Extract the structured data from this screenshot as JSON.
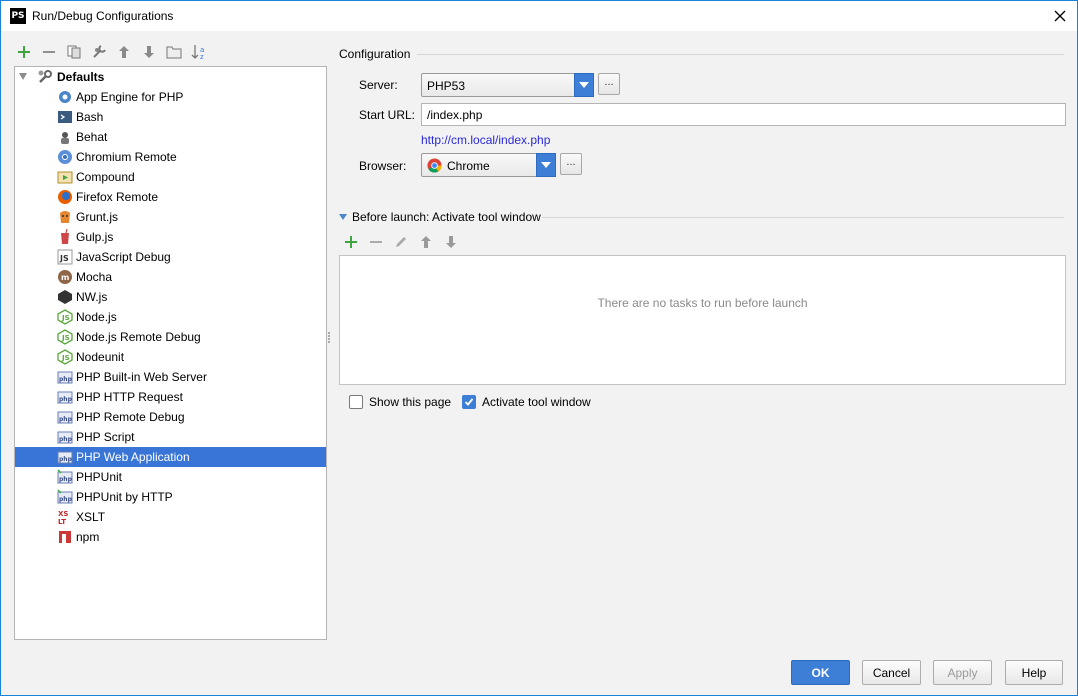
{
  "window": {
    "title": "Run/Debug Configurations",
    "app_icon_text": "PS"
  },
  "toolbar": {
    "buttons": [
      "add-icon",
      "remove-icon",
      "copy-icon",
      "edit-defaults-icon",
      "move-up-icon",
      "move-down-icon",
      "folder-icon",
      "sort-icon"
    ]
  },
  "tree": {
    "root_label": "Defaults",
    "items": [
      {
        "label": "App Engine for PHP",
        "icon": "app-engine-icon"
      },
      {
        "label": "Bash",
        "icon": "bash-icon"
      },
      {
        "label": "Behat",
        "icon": "behat-icon"
      },
      {
        "label": "Chromium Remote",
        "icon": "chromium-icon"
      },
      {
        "label": "Compound",
        "icon": "compound-icon"
      },
      {
        "label": "Firefox Remote",
        "icon": "firefox-icon"
      },
      {
        "label": "Grunt.js",
        "icon": "grunt-icon"
      },
      {
        "label": "Gulp.js",
        "icon": "gulp-icon"
      },
      {
        "label": "JavaScript Debug",
        "icon": "js-debug-icon"
      },
      {
        "label": "Mocha",
        "icon": "mocha-icon"
      },
      {
        "label": "NW.js",
        "icon": "nwjs-icon"
      },
      {
        "label": "Node.js",
        "icon": "nodejs-icon"
      },
      {
        "label": "Node.js Remote Debug",
        "icon": "nodejs-remote-icon"
      },
      {
        "label": "Nodeunit",
        "icon": "nodeunit-icon"
      },
      {
        "label": "PHP Built-in Web Server",
        "icon": "php-server-icon"
      },
      {
        "label": "PHP HTTP Request",
        "icon": "php-http-icon"
      },
      {
        "label": "PHP Remote Debug",
        "icon": "php-remote-icon"
      },
      {
        "label": "PHP Script",
        "icon": "php-script-icon"
      },
      {
        "label": "PHP Web Application",
        "icon": "php-web-icon",
        "selected": true
      },
      {
        "label": "PHPUnit",
        "icon": "phpunit-icon"
      },
      {
        "label": "PHPUnit by HTTP",
        "icon": "phpunit-http-icon"
      },
      {
        "label": "XSLT",
        "icon": "xslt-icon"
      },
      {
        "label": "npm",
        "icon": "npm-icon"
      }
    ]
  },
  "config": {
    "section_title": "Configuration",
    "server_label": "Server:",
    "server_value": "PHP53",
    "start_url_label": "Start URL:",
    "start_url_value": "/index.php",
    "resolved_url": "http://cm.local/index.php",
    "browser_label": "Browser:",
    "browser_value": "Chrome",
    "dots_label": "..."
  },
  "before_launch": {
    "header": "Before launch: Activate tool window",
    "empty_text": "There are no tasks to run before launch",
    "toolbar": [
      "add-icon",
      "remove-icon",
      "edit-icon",
      "move-up-icon",
      "move-down-icon"
    ]
  },
  "options": {
    "show_page_label": "Show this page",
    "show_page_checked": false,
    "activate_tool_label": "Activate tool window",
    "activate_tool_checked": true
  },
  "buttons": {
    "ok": "OK",
    "cancel": "Cancel",
    "apply": "Apply",
    "help": "Help"
  },
  "colors": {
    "selection": "#3875d7",
    "accent": "#3d7ed6",
    "link": "#2a2ad8",
    "add_green": "#3fa53f"
  }
}
